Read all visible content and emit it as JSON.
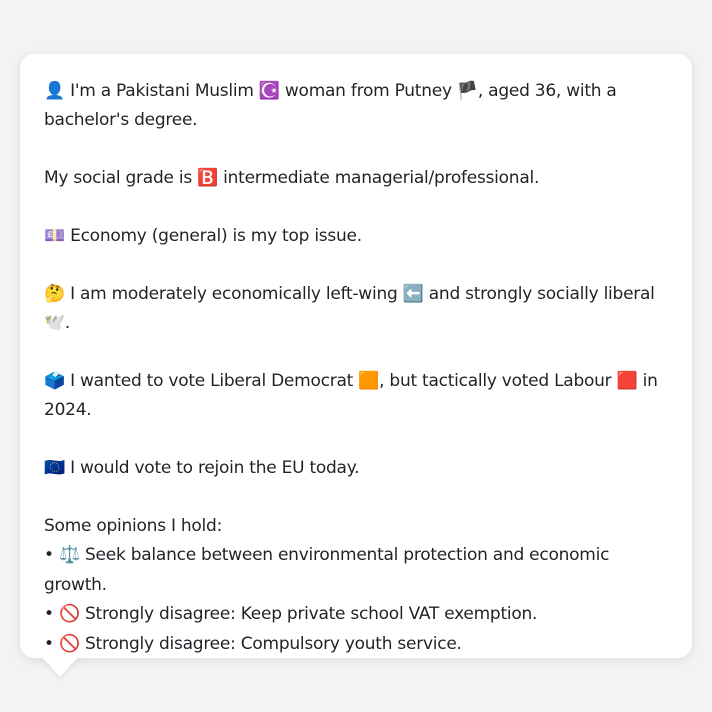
{
  "message": {
    "line1": {
      "icon": "👤",
      "text_a": " I'm a Pakistani Muslim ",
      "icon_b": "☪️",
      "text_b": " woman from Putney ",
      "icon_c": "🏴",
      "text_c": ", aged 36, with a bachelor's degree."
    },
    "line2": {
      "text_a": "My social grade is ",
      "icon": "🅱️",
      "text_b": " intermediate managerial/professional."
    },
    "line3": {
      "icon": "💷",
      "text": " Economy (general) is my top issue."
    },
    "line4": {
      "icon": "🤔",
      "text_a": " I am moderately economically left-wing ",
      "icon_b": "⬅️",
      "text_b": " and strongly socially liberal ",
      "icon_c": "🕊️",
      "text_c": "."
    },
    "line5": {
      "icon": "🗳️",
      "text_a": " I wanted to vote Liberal Democrat ",
      "icon_b": "🟧",
      "text_b": ", but tactically voted Labour ",
      "icon_c": "🟥",
      "text_c": " in 2024."
    },
    "line6": {
      "icon": "🇪🇺",
      "text": " I would vote to rejoin the EU today."
    },
    "opinions_heading": "Some opinions I hold:",
    "opinions": [
      {
        "bullet": "• ",
        "icon": "⚖️",
        "text": " Seek balance between environmental protection and economic growth."
      },
      {
        "bullet": "• ",
        "icon": "🚫",
        "text": " Strongly disagree: Keep private school VAT exemption."
      },
      {
        "bullet": "• ",
        "icon": "🚫",
        "text": " Strongly disagree: Compulsory youth service."
      }
    ]
  }
}
